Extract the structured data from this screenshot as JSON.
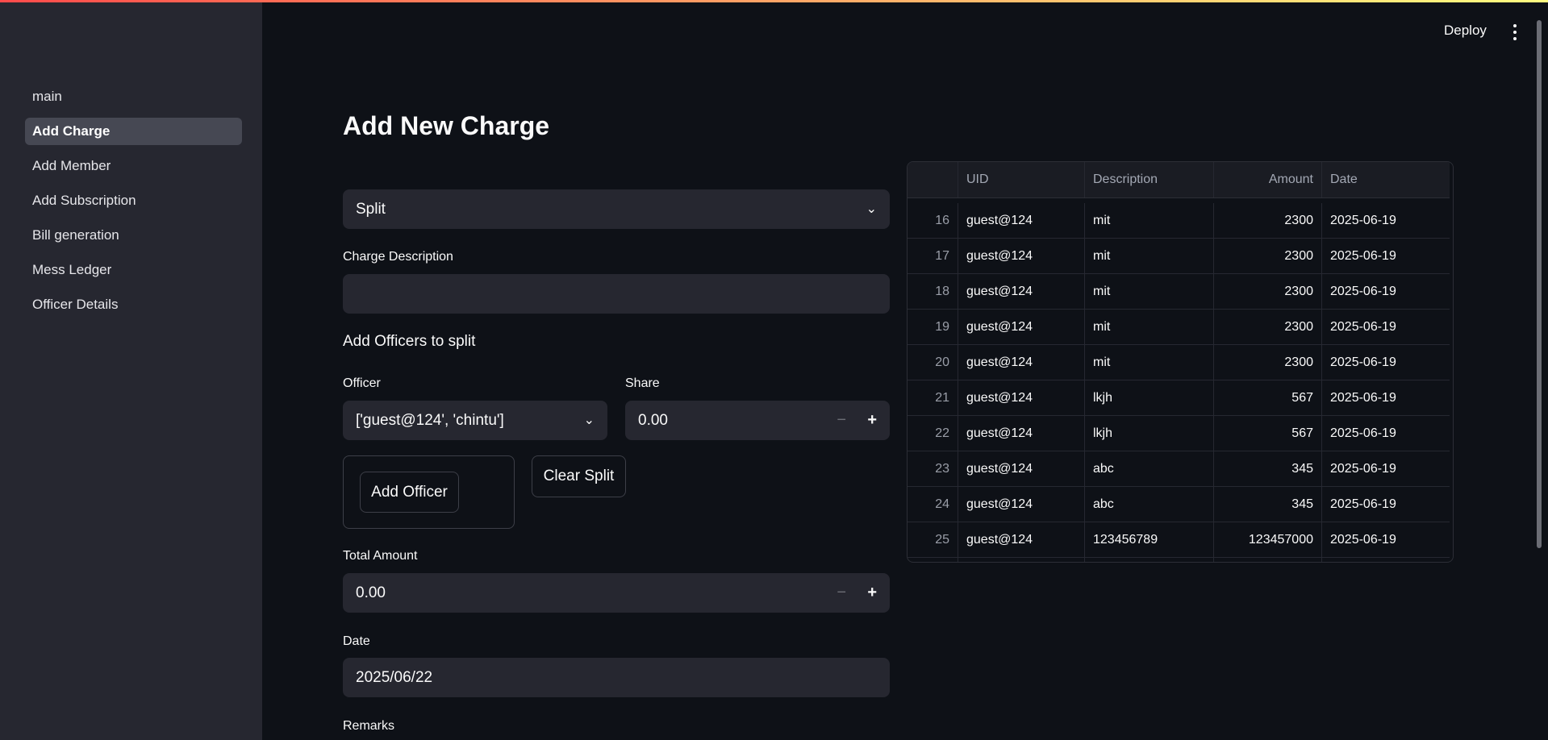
{
  "header": {
    "deploy_label": "Deploy",
    "menu_icon": "kebab-vertical-icon"
  },
  "colors": {
    "accent_gradient_start": "#ff4b4b",
    "accent_gradient_end": "#fffd80",
    "background": "#0e1117",
    "sidebar": "#262730"
  },
  "sidebar": {
    "items": [
      {
        "label": "main",
        "active": false
      },
      {
        "label": "Add Charge",
        "active": true
      },
      {
        "label": "Add Member",
        "active": false
      },
      {
        "label": "Add Subscription",
        "active": false
      },
      {
        "label": "Bill generation",
        "active": false
      },
      {
        "label": "Mess Ledger",
        "active": false
      },
      {
        "label": "Officer Details",
        "active": false
      }
    ]
  },
  "main": {
    "title": "Add New Charge",
    "charge_type": {
      "value": "Split"
    },
    "charge_description": {
      "label": "Charge Description",
      "value": ""
    },
    "split_heading": "Add Officers to split",
    "officer": {
      "label": "Officer",
      "value": "['guest@124', 'chintu']"
    },
    "share": {
      "label": "Share",
      "value": "0.00"
    },
    "add_officer_label": "Add Officer",
    "clear_split_label": "Clear Split",
    "total_amount": {
      "label": "Total Amount",
      "value": "0.00"
    },
    "date": {
      "label": "Date",
      "value": "2025/06/22"
    },
    "remarks": {
      "label": "Remarks"
    },
    "stepper": {
      "minus": "−",
      "plus": "+"
    }
  },
  "table": {
    "columns": [
      "",
      "UID",
      "Description",
      "Amount",
      "Date"
    ],
    "rows": [
      [
        "16",
        "guest@124",
        "mit",
        "2300",
        "2025-06-19"
      ],
      [
        "17",
        "guest@124",
        "mit",
        "2300",
        "2025-06-19"
      ],
      [
        "18",
        "guest@124",
        "mit",
        "2300",
        "2025-06-19"
      ],
      [
        "19",
        "guest@124",
        "mit",
        "2300",
        "2025-06-19"
      ],
      [
        "20",
        "guest@124",
        "mit",
        "2300",
        "2025-06-19"
      ],
      [
        "21",
        "guest@124",
        "lkjh",
        "567",
        "2025-06-19"
      ],
      [
        "22",
        "guest@124",
        "lkjh",
        "567",
        "2025-06-19"
      ],
      [
        "23",
        "guest@124",
        "abc",
        "345",
        "2025-06-19"
      ],
      [
        "24",
        "guest@124",
        "abc",
        "345",
        "2025-06-19"
      ],
      [
        "25",
        "guest@124",
        "123456789",
        "123457000",
        "2025-06-19"
      ]
    ]
  }
}
